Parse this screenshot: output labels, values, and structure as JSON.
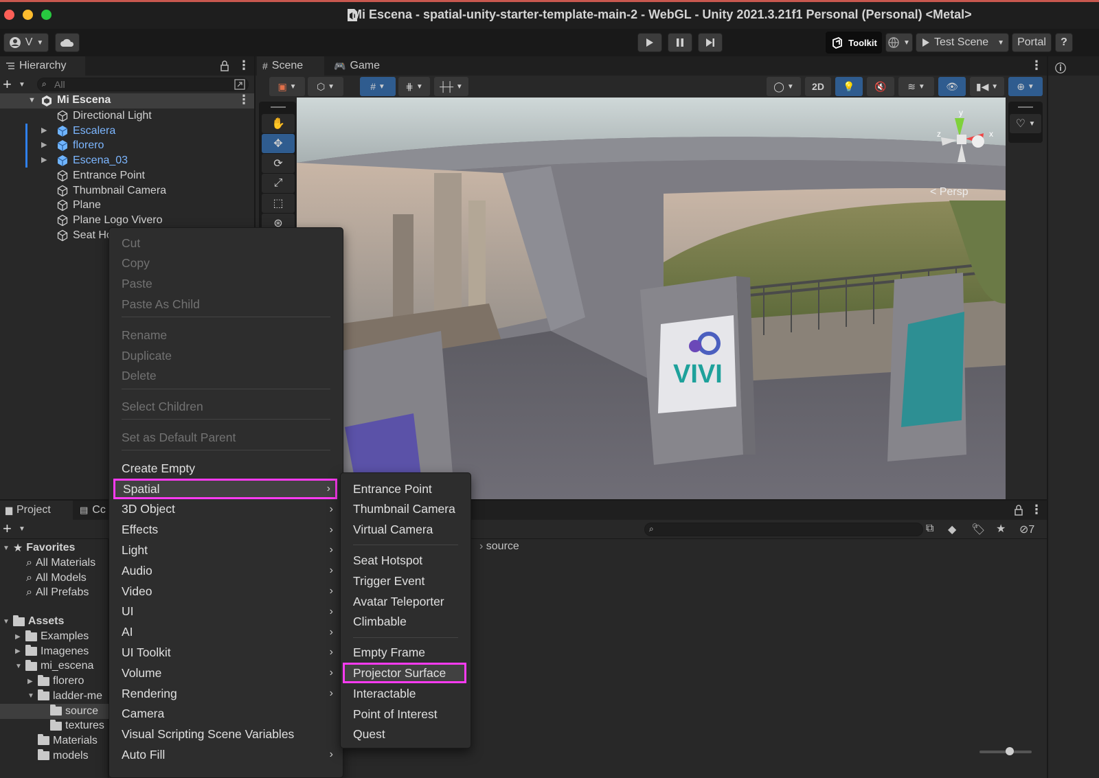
{
  "window": {
    "title": "Mi Escena - spatial-unity-starter-template-main-2 - WebGL - Unity 2021.3.21f1 Personal (Personal) <Metal>",
    "account_label": "V"
  },
  "toolbar": {
    "toolkit_label": "Toolkit",
    "test_scene_label": "Test Scene",
    "portal_label": "Portal",
    "help_label": "?"
  },
  "hierarchy": {
    "tab_label": "Hierarchy",
    "search_placeholder": "All",
    "scene_name": "Mi Escena",
    "items": [
      {
        "label": "Directional Light",
        "prefab": false,
        "expandable": false
      },
      {
        "label": "Escalera",
        "prefab": true,
        "expandable": true
      },
      {
        "label": "florero",
        "prefab": true,
        "expandable": true
      },
      {
        "label": "Escena_03",
        "prefab": true,
        "expandable": true
      },
      {
        "label": "Entrance Point",
        "prefab": false,
        "expandable": false
      },
      {
        "label": "Thumbnail Camera",
        "prefab": false,
        "expandable": false
      },
      {
        "label": "Plane",
        "prefab": false,
        "expandable": false
      },
      {
        "label": "Plane Logo Vivero",
        "prefab": false,
        "expandable": false
      },
      {
        "label": "Seat Ho",
        "prefab": false,
        "expandable": false
      }
    ]
  },
  "scene_view": {
    "tabs": [
      {
        "label": "Scene",
        "icon": "hash-icon"
      },
      {
        "label": "Game",
        "icon": "gamepad-icon"
      }
    ],
    "mode_2d_label": "2D",
    "persp_label": "< Persp",
    "gizmo_axes": {
      "y": "y",
      "x": "x",
      "z": "z"
    },
    "poster_text": "VIVI"
  },
  "project": {
    "tabs": [
      {
        "label": "Project"
      },
      {
        "label": "Cc"
      }
    ],
    "breadcrumb": "source",
    "hidden_count": "7",
    "favorites_label": "Favorites",
    "favorites": [
      "All Materials",
      "All Models",
      "All Prefabs"
    ],
    "assets_label": "Assets",
    "tree": [
      {
        "label": "Examples",
        "depth": 1,
        "arrow": "right"
      },
      {
        "label": "Imagenes",
        "depth": 1,
        "arrow": "right"
      },
      {
        "label": "mi_escena",
        "depth": 1,
        "arrow": "down"
      },
      {
        "label": "florero",
        "depth": 2,
        "arrow": "right"
      },
      {
        "label": "ladder-me",
        "depth": 2,
        "arrow": "down"
      },
      {
        "label": "source",
        "depth": 3,
        "arrow": "",
        "selected": true
      },
      {
        "label": "textures",
        "depth": 3,
        "arrow": ""
      },
      {
        "label": "Materials",
        "depth": 2,
        "arrow": ""
      },
      {
        "label": "models",
        "depth": 2,
        "arrow": ""
      }
    ]
  },
  "context_menu": {
    "edit_items": [
      "Cut",
      "Copy",
      "Paste",
      "Paste As Child"
    ],
    "object_items": [
      "Rename",
      "Duplicate",
      "Delete"
    ],
    "select_children": "Select Children",
    "set_default_parent": "Set as Default Parent",
    "create_items": [
      {
        "label": "Create Empty",
        "submenu": false
      },
      {
        "label": "Spatial",
        "submenu": true,
        "highlighted": true
      },
      {
        "label": "3D Object",
        "submenu": true
      },
      {
        "label": "Effects",
        "submenu": true
      },
      {
        "label": "Light",
        "submenu": true
      },
      {
        "label": "Audio",
        "submenu": true
      },
      {
        "label": "Video",
        "submenu": true
      },
      {
        "label": "UI",
        "submenu": true
      },
      {
        "label": "AI",
        "submenu": true
      },
      {
        "label": "UI Toolkit",
        "submenu": true
      },
      {
        "label": "Volume",
        "submenu": true
      },
      {
        "label": "Rendering",
        "submenu": true
      },
      {
        "label": "Camera",
        "submenu": false
      },
      {
        "label": "Visual Scripting Scene Variables",
        "submenu": false
      },
      {
        "label": "Auto Fill",
        "submenu": true
      }
    ]
  },
  "spatial_submenu": {
    "group1": [
      "Entrance Point",
      "Thumbnail Camera",
      "Virtual Camera"
    ],
    "group2": [
      "Seat Hotspot",
      "Trigger Event",
      "Avatar Teleporter",
      "Climbable"
    ],
    "group3": [
      "Empty Frame",
      "Projector Surface",
      "Interactable",
      "Point of Interest",
      "Quest"
    ],
    "highlighted_item": "Projector Surface"
  },
  "colors": {
    "highlight_border": "#ff3bf2",
    "menu_selection": "#414141",
    "prefab_text": "#7cb6ff",
    "active_tool": "#2f5c8f"
  }
}
